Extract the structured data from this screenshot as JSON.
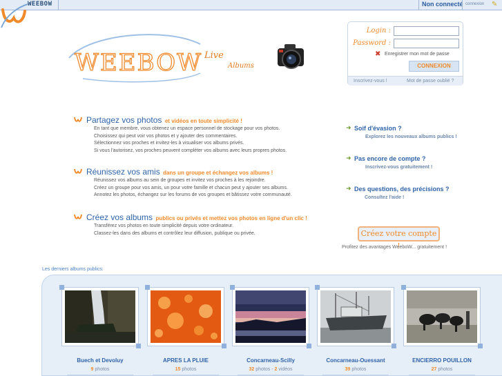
{
  "topbar": {
    "brand": "WEEBOW",
    "status": "Non connecté",
    "connexion_link": "connexion"
  },
  "header": {
    "logo_text": "WEEBOW",
    "tagline_1": "Live",
    "tagline_2": "Albums"
  },
  "login": {
    "login_label": "Login :",
    "password_label": "Password :",
    "login_value": "",
    "password_value": "",
    "remember_label": "Enregistrer mon mot de passe",
    "submit_label": "CONNEXION",
    "register_link": "Inscrivez-vous !",
    "forgot_link": "Mot de passe oublié ?"
  },
  "features": [
    {
      "title": "Partagez vos photos",
      "subtitle": "et vidéos en toute simplicité !",
      "lines": [
        "En tant que membre, vous obtenez un espace personnel de stockage pour vos photos.",
        "Choisissez qui peut voir vos photos et y ajouter des commentaires.",
        "Sélectionnez vos proches et invitez-les à visualiser vos albums privés.",
        "Si vous l'autorisez, vos proches peuvent compléter vos albums avec leurs propres photos."
      ]
    },
    {
      "title": "Réunissez vos amis",
      "subtitle": "dans un groupe et échangez vos albums !",
      "lines": [
        "Réunissez vos albums au sein de groupes et invitez vos proches à les rejoindre.",
        "Créez un groupe pour vos amis, un pour votre famille et chacun peut y ajouter ses albums.",
        "Annotez les photos, échangez sur les forums de vos groupes et bâtissez votre communauté."
      ]
    },
    {
      "title": "Créez vos albums",
      "subtitle": "publics ou privés et mettez vos photos en ligne d'un clic !",
      "lines": [
        "Transférez vos photos en toute simplicité depuis votre ordinateur.",
        "Classez-les dans des albums et contrôlez leur diffusion, publique ou privée."
      ]
    }
  ],
  "side": [
    {
      "question": "Soif d'évasion ?",
      "link": "Explorez les nouveaux albums publics !"
    },
    {
      "question": "Pas encore de compte ?",
      "link": "Inscrivez-vous gratuitement !"
    },
    {
      "question": "Des questions, des précisions ?",
      "link": "Consultez l'aide !"
    }
  ],
  "cta": {
    "button": "Créez votre compte !",
    "subtext": "Profitez des avantages WeeboW... gratuitement !"
  },
  "albums": {
    "label": "Les derniers albums publics:",
    "items": [
      {
        "name": "Buech et Devoluy",
        "photos": "9",
        "photos_label": "photos",
        "videos": "",
        "videos_label": ""
      },
      {
        "name": "APRES LA PLUIE",
        "photos": "15",
        "photos_label": "photos",
        "videos": "",
        "videos_label": ""
      },
      {
        "name": "Concarneau-Scilly",
        "photos": "32",
        "photos_label": "photos -",
        "videos": "2",
        "videos_label": "vidéos"
      },
      {
        "name": "Concarneau-Ouessant",
        "photos": "39",
        "photos_label": "photos",
        "videos": "",
        "videos_label": ""
      },
      {
        "name": "ENCIERRO POUILLON",
        "photos": "27",
        "photos_label": "photos",
        "videos": "",
        "videos_label": ""
      }
    ]
  },
  "colors": {
    "accent_orange": "#f08a2b",
    "link_blue": "#2f63a8",
    "panel_blue": "#e6eef8"
  }
}
